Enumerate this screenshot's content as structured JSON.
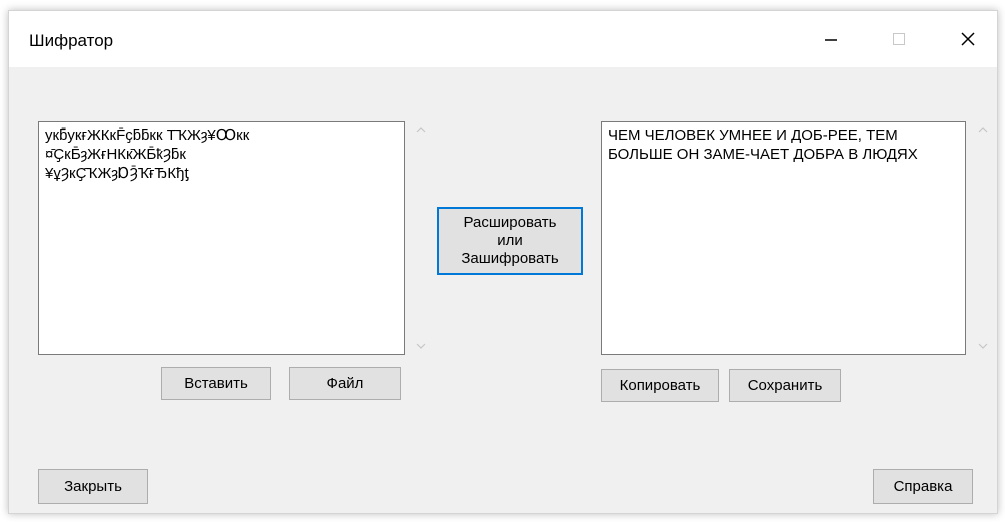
{
  "window": {
    "title": "Шифратор",
    "controls": {
      "minimize": "minimize-icon",
      "maximize": "maximize-icon",
      "close": "close-icon"
    }
  },
  "left_box": {
    "text": "укƃ̄укғЖКкF̄ҫƃƃкк Т̄ҠЖȝ¥Ꝏкк\n¤̄ҪкƂ̄ȝЖғНКк̄ЖƂ̄ҟȜƃк\n¥ұȜкҪ̄ҠЖȝⱰȜ̄Ҡ̄ғЂКђƫ"
  },
  "right_box": {
    "text": "ЧЕМ ЧЕЛОВЕК УМНЕЕ И ДОБ-РЕЕ, ТЕМ БОЛЬШЕ ОН ЗАМЕ-ЧАЕТ ДОБРА В ЛЮДЯХ"
  },
  "buttons": {
    "decrypt_line1": "Расшировать",
    "decrypt_line2": "или",
    "decrypt_line3": "Зашифровать",
    "insert": "Вставить",
    "file": "Файл",
    "copy": "Копировать",
    "save": "Сохранить",
    "close": "Закрыть",
    "help": "Справка"
  }
}
